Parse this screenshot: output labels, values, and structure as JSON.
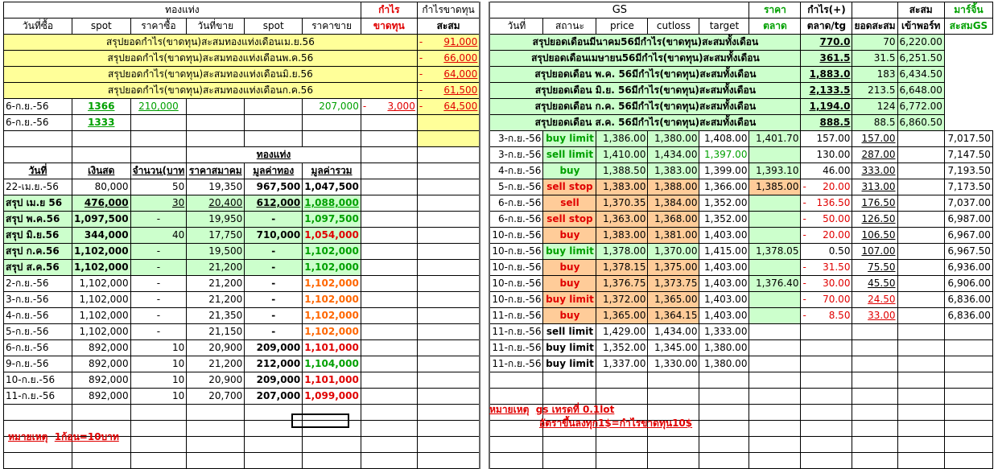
{
  "left": {
    "hdr1": {
      "gold": "ทองแท่ง",
      "profit": "กำไร",
      "profit_loss": "กำไรขาดทุน"
    },
    "hdr2": [
      "วันที่ซื้อ",
      "spot",
      "ราคาซื้อ",
      "วันที่ขาย",
      "spot",
      "ราคาขาย",
      "ขาดทุน",
      "สะสม"
    ],
    "summary": [
      {
        "label": "สรุปยอดกำไร(ขาดทุน)สะสมทองแท่งเดือนเม.ย.56",
        "sign": "-",
        "value": "91,000"
      },
      {
        "label": "สรุปยอดกำไร(ขาดทุน)สะสมทองแท่งเดือนพ.ค.56",
        "sign": "-",
        "value": "66,000"
      },
      {
        "label": "สรุปยอดกำไร(ขาดทุน)สะสมทองแท่งเดือนมิ.ย.56",
        "sign": "-",
        "value": "64,000"
      },
      {
        "label": "สรุปยอดกำไร(ขาดทุน)สะสมทองแท่งเดือนก.ค.56",
        "sign": "-",
        "value": "61,500"
      }
    ],
    "trade1": {
      "date": "6-ก.ย.-56",
      "spot": "1366",
      "buy": "210,000",
      "sell": "207,000",
      "sign": "-",
      "pl": "3,000",
      "sign2": "-",
      "cum": "64,500"
    },
    "trade2": {
      "date": "6-ก.ย.-56",
      "spot": "1333"
    },
    "gold_title": "ทองแท่ง",
    "hdr3": [
      "วันที่",
      "เงินสด",
      "จำนวน(บาท",
      "ราคาสมาคม",
      "มูลค่าทอง",
      "มูลค่ารวม"
    ],
    "rows": [
      {
        "date": "22-เม.ย.-56",
        "cash": "80,000",
        "qty": "50",
        "price": "19,350",
        "gold": "967,500",
        "total": "1,047,500"
      },
      {
        "date": "สรุป เม.ย 56",
        "cash": "476,000",
        "qty": "30",
        "price": "20,400",
        "gold": "612,000",
        "total": "1,088,000"
      },
      {
        "date": "สรุป พ.ค.56",
        "cash": "1,097,500",
        "qty": "-",
        "price": "19,950",
        "gold": "-",
        "total": "1,097,500"
      },
      {
        "date": "สรุป มิ.ย.56",
        "cash": "344,000",
        "qty": "40",
        "price": "17,750",
        "gold": "710,000",
        "total": "1,054,000"
      },
      {
        "date": "สรุป ก.ค.56",
        "cash": "1,102,000",
        "qty": "-",
        "price": "19,500",
        "gold": "-",
        "total": "1,102,000"
      },
      {
        "date": "สรุป ส.ค.56",
        "cash": "1,102,000",
        "qty": "-",
        "price": "21,200",
        "gold": "-",
        "total": "1,102,000"
      },
      {
        "date": "2-ก.ย.-56",
        "cash": "1,102,000",
        "qty": "-",
        "price": "21,200",
        "gold": "-",
        "total": "1,102,000"
      },
      {
        "date": "3-ก.ย.-56",
        "cash": "1,102,000",
        "qty": "-",
        "price": "21,200",
        "gold": "-",
        "total": "1,102,000"
      },
      {
        "date": "4-ก.ย.-56",
        "cash": "1,102,000",
        "qty": "-",
        "price": "21,350",
        "gold": "-",
        "total": "1,102,000"
      },
      {
        "date": "5-ก.ย.-56",
        "cash": "1,102,000",
        "qty": "-",
        "price": "21,150",
        "gold": "-",
        "total": "1,102,000"
      },
      {
        "date": "6-ก.ย.-56",
        "cash": "892,000",
        "qty": "10",
        "price": "20,900",
        "gold": "209,000",
        "total": "1,101,000"
      },
      {
        "date": "9-ก.ย.-56",
        "cash": "892,000",
        "qty": "10",
        "price": "21,200",
        "gold": "212,000",
        "total": "1,104,000"
      },
      {
        "date": "10-ก.ย.-56",
        "cash": "892,000",
        "qty": "10",
        "price": "20,900",
        "gold": "209,000",
        "total": "1,101,000"
      },
      {
        "date": "11-ก.ย.-56",
        "cash": "892,000",
        "qty": "10",
        "price": "20,700",
        "gold": "207,000",
        "total": "1,099,000"
      }
    ],
    "note": {
      "label": "หมายเหตุ",
      "text": "1ก้อน=10บาท"
    }
  },
  "right": {
    "hdr1": {
      "gs": "GS",
      "price": "ราคา",
      "profit": "กำไร(+)",
      "cum": "สะสม",
      "margin": "มาร์จิ้น"
    },
    "hdr2": [
      "วันที่",
      "สถานะ",
      "price",
      "cutloss",
      "target",
      "ตลาด",
      "ตลาด/tg",
      "ยอดสะสม",
      "เข้าพอร์ท",
      "สะสมGS"
    ],
    "monthly": [
      {
        "label": "สรุปยอดเดือนมีนาคม56มีกำไร(ขาดทุน)สะสมทั้งเดือน",
        "value": "770.0",
        "port": "70",
        "gs": "6,220.00"
      },
      {
        "label": "สรุปยอดเดือนเมษายน56มีกำไร(ขาดทุน)สะสมทั้งเดือน",
        "value": "361.5",
        "port": "31.5",
        "gs": "6,251.50"
      },
      {
        "label": "สรุปยอดเดือน พ.ค. 56มีกำไร(ขาดทุน)สะสมทั้งเดือน",
        "value": "1,883.0",
        "port": "183",
        "gs": "6,434.50"
      },
      {
        "label": "สรุปยอดเดือน มิ.ย. 56มีกำไร(ขาดทุน)สะสมทั้งเดือน",
        "value": "2,133.5",
        "port": "213.5",
        "gs": "6,648.00"
      },
      {
        "label": "สรุปยอดเดือน ก.ค. 56มีกำไร(ขาดทุน)สะสมทั้งเดือน",
        "value": "1,194.0",
        "port": "124",
        "gs": "6,772.00"
      },
      {
        "label": "สรุปยอดเดือน ส.ค. 56มีกำไร(ขาดทุน)สะสมทั้งเดือน",
        "value": "888.5",
        "port": "88.5",
        "gs": "6,860.50"
      }
    ],
    "trades": [
      {
        "date": "3-ก.ย.-56",
        "status": "buy limit",
        "price": "1,386.00",
        "cut": "1,380.00",
        "target": "1,408.00",
        "mkt": "1,401.70",
        "sign": "",
        "pl": "157.00",
        "cum": "157.00",
        "gs": "7,017.50"
      },
      {
        "date": "3-ก.ย.-56",
        "status": "sell limit",
        "price": "1,410.00",
        "cut": "1,434.00",
        "target": "1,397.00",
        "mkt": "",
        "sign": "",
        "pl": "130.00",
        "cum": "287.00",
        "gs": "7,147.50"
      },
      {
        "date": "4-ก.ย.-56",
        "status": "buy",
        "price": "1,388.50",
        "cut": "1,383.00",
        "target": "1,399.00",
        "mkt": "1,393.10",
        "sign": "",
        "pl": "46.00",
        "cum": "333.00",
        "gs": "7,193.50"
      },
      {
        "date": "5-ก.ย.-56",
        "status": "sell stop",
        "price": "1,383.00",
        "cut": "1,388.00",
        "target": "1,366.00",
        "mkt": "1,385.00",
        "sign": "-",
        "pl": "20.00",
        "cum": "313.00",
        "gs": "7,173.50"
      },
      {
        "date": "6-ก.ย.-56",
        "status": "sell",
        "price": "1,370.35",
        "cut": "1,384.00",
        "target": "1,352.00",
        "mkt": "",
        "sign": "-",
        "pl": "136.50",
        "cum": "176.50",
        "gs": "7,037.00"
      },
      {
        "date": "6-ก.ย.-56",
        "status": "sell stop",
        "price": "1,363.00",
        "cut": "1,368.00",
        "target": "1,352.00",
        "mkt": "",
        "sign": "-",
        "pl": "50.00",
        "cum": "126.50",
        "gs": "6,987.00"
      },
      {
        "date": "10-ก.ย.-56",
        "status": "buy",
        "price": "1,383.00",
        "cut": "1,381.00",
        "target": "1,403.00",
        "mkt": "",
        "sign": "-",
        "pl": "20.00",
        "cum": "106.50",
        "gs": "6,967.00"
      },
      {
        "date": "10-ก.ย.-56",
        "status": "buy limit",
        "price": "1,378.00",
        "cut": "1,370.00",
        "target": "1,415.00",
        "mkt": "1,378.05",
        "sign": "",
        "pl": "0.50",
        "cum": "107.00",
        "gs": "6,967.50"
      },
      {
        "date": "10-ก.ย.-56",
        "status": "buy",
        "price": "1,378.15",
        "cut": "1,375.00",
        "target": "1,403.00",
        "mkt": "",
        "sign": "-",
        "pl": "31.50",
        "cum": "75.50",
        "gs": "6,936.00"
      },
      {
        "date": "10-ก.ย.-56",
        "status": "buy",
        "price": "1,376.75",
        "cut": "1,373.75",
        "target": "1,403.00",
        "mkt": "1,376.40",
        "sign": "-",
        "pl": "30.00",
        "cum": "45.50",
        "gs": "6,906.00"
      },
      {
        "date": "10-ก.ย.-56",
        "status": "buy limit",
        "price": "1,372.00",
        "cut": "1,365.00",
        "target": "1,403.00",
        "mkt": "",
        "sign": "-",
        "pl": "70.00",
        "cum": "24.50",
        "gs": "6,836.00"
      },
      {
        "date": "11-ก.ย.-56",
        "status": "buy",
        "price": "1,365.00",
        "cut": "1,364.15",
        "target": "1,403.00",
        "mkt": "",
        "sign": "-",
        "pl": "8.50",
        "cum": "33.00",
        "gs": "6,836.00"
      },
      {
        "date": "11-ก.ย.-56",
        "status": "sell limit",
        "price": "1,429.00",
        "cut": "1,434.00",
        "target": "1,333.00",
        "mkt": "",
        "sign": "",
        "pl": "",
        "cum": "",
        "gs": ""
      },
      {
        "date": "11-ก.ย.-56",
        "status": "buy limit",
        "price": "1,352.00",
        "cut": "1,345.00",
        "target": "1,380.00",
        "mkt": "",
        "sign": "",
        "pl": "",
        "cum": "",
        "gs": ""
      },
      {
        "date": "11-ก.ย.-56",
        "status": "buy limit",
        "price": "1,337.00",
        "cut": "1,330.00",
        "target": "1,380.00",
        "mkt": "",
        "sign": "",
        "pl": "",
        "cum": "",
        "gs": ""
      }
    ],
    "note": {
      "label": "หมายเหตุ",
      "text1": "gs เทรดที่ 0.1lot",
      "text2": "อัตราขึ้นลงทุก1$=กำไรขาดทุน10$"
    }
  }
}
